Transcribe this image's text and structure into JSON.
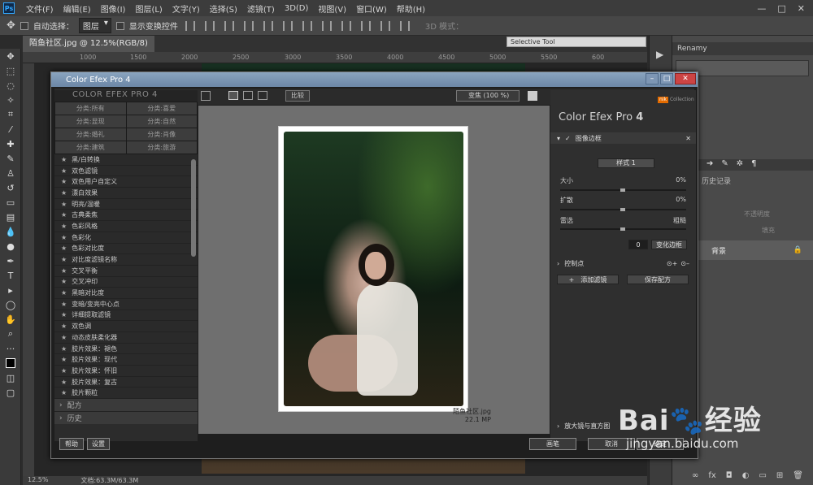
{
  "app": {
    "logo": "Ps",
    "menu": [
      "文件(F)",
      "编辑(E)",
      "图像(I)",
      "图层(L)",
      "文字(Y)",
      "选择(S)",
      "滤镜(T)",
      "3D(D)",
      "视图(V)",
      "窗口(W)",
      "帮助(H)"
    ],
    "window_controls": [
      "—",
      "□",
      "✕"
    ]
  },
  "options": {
    "auto_select_label": "自动选择：",
    "auto_select_value": "图层",
    "show_transform_label": "显示变换控件",
    "mode3d_label": "3D 模式："
  },
  "document": {
    "tab_label": "陌鱼社区.jpg @ 12.5%(RGB/8)",
    "zoom": "12.5%",
    "doc_info": "文档:63.3M/63.3M",
    "ruler_ticks": [
      "1000",
      "1500",
      "2000",
      "2500",
      "3000",
      "3500",
      "4000",
      "4500",
      "5000",
      "5500",
      "600"
    ]
  },
  "selective_tool": {
    "title": "Selective Tool"
  },
  "right_panel": {
    "renamy_label": "Renamy",
    "history_label": "历史记录",
    "opacity_label": "不透明度",
    "fill_label": "填充",
    "layer_name": "背景"
  },
  "dialog": {
    "title": "Color Efex Pro 4",
    "compare_label": "比较",
    "zoom_label": "变焦 (100 %)",
    "left": {
      "header": "COLOR EFEX PRO 4",
      "categories": [
        "分类:所有",
        "分类:喜爱",
        "分类:显现",
        "分类:自然",
        "分类:婚礼",
        "分类:肖像",
        "分类:建筑",
        "分类:旅游"
      ],
      "filters": [
        "黑/白转换",
        "双色滤镜",
        "双色用户自定义",
        "漂白效果",
        "明亮/温暖",
        "古典柔焦",
        "色彩风格",
        "色彩化",
        "色彩对比度",
        "对比度滤镜名称",
        "交叉平衡",
        "交叉冲印",
        "黑暗对比度",
        "变暗/变亮中心点",
        "详细提取滤镜",
        "双色调",
        "动态皮肤柔化器",
        "胶片效果：褪色",
        "胶片效果：现代",
        "胶片效果：怀旧",
        "胶片效果：复古",
        "胶片颗粒"
      ],
      "presets_label": "配方",
      "history_label": "历史"
    },
    "preview": {
      "file_name": "陌鱼社区.jpg",
      "file_size": "22.1 MP"
    },
    "right": {
      "brand": "nik",
      "brand_sub": "Collection",
      "title": "Color Efex Pro",
      "title_num": "4",
      "section_title": "图像边框",
      "preset": "样式 1",
      "sliders": [
        {
          "label": "大小",
          "value": "0%"
        },
        {
          "label": "扩散",
          "value": "0%"
        },
        {
          "label": "雷选",
          "value": "粗糙"
        }
      ],
      "vary_value": "0",
      "vary_button": "变化边框",
      "control_points": "控制点",
      "add_filter": "添加滤镜",
      "save_recipe": "保存配方",
      "loupe_label": "放大镜与直方图"
    },
    "footer": {
      "help": "帮助",
      "settings": "设置",
      "brush": "画笔",
      "cancel": "取消",
      "ok": "确定"
    }
  },
  "watermark": {
    "logo_text": "Bai",
    "logo_suffix": "经验",
    "url": "jingyan.baidu.com"
  }
}
